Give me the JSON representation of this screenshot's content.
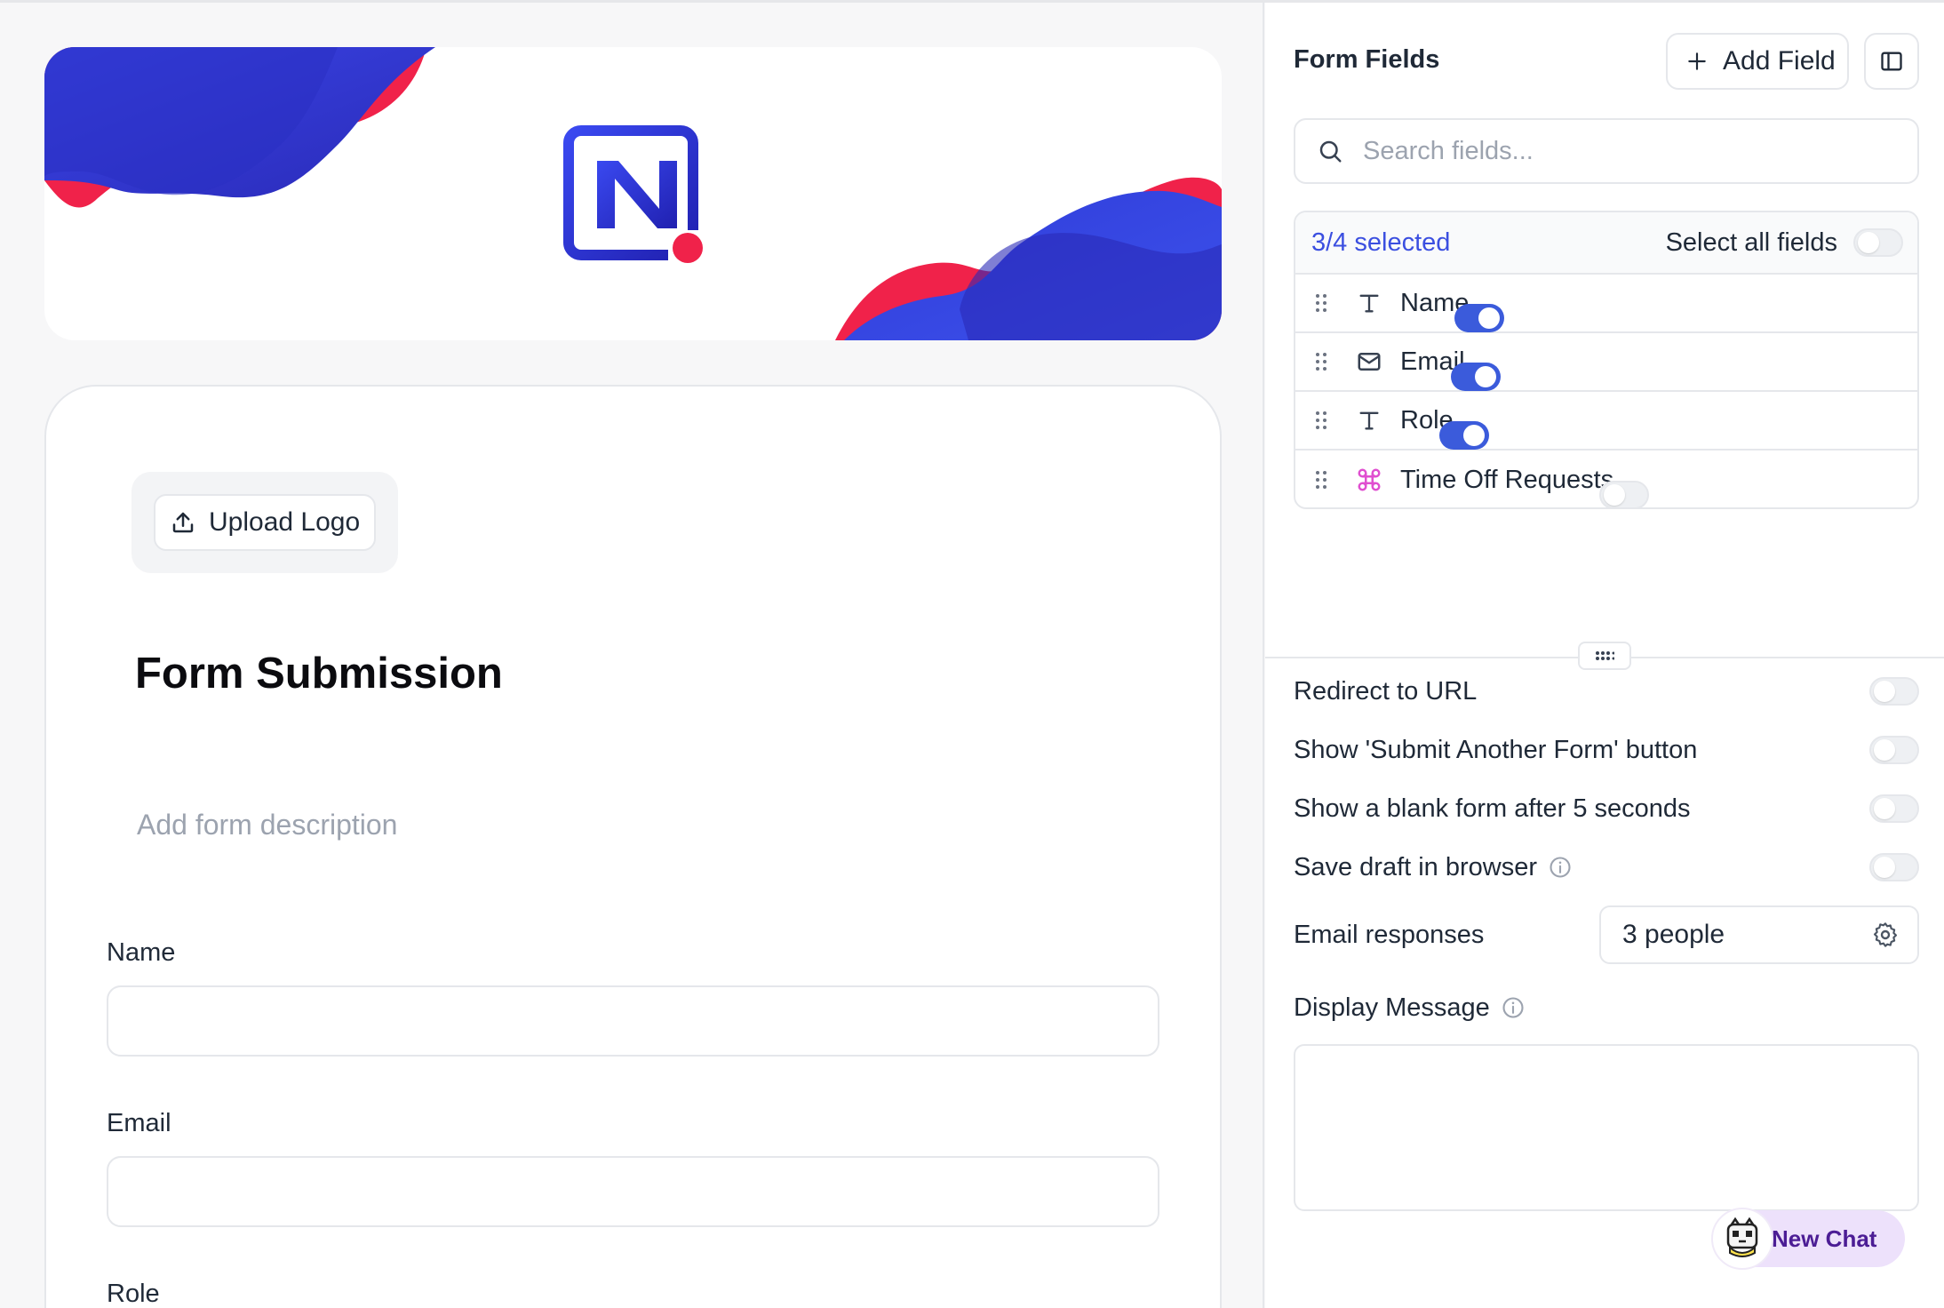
{
  "form": {
    "upload_logo_label": "Upload Logo",
    "title": "Form Submission",
    "description_placeholder": "Add form description",
    "fields": [
      {
        "label": "Name"
      },
      {
        "label": "Email"
      },
      {
        "label": "Role"
      }
    ]
  },
  "panel": {
    "title": "Form Fields",
    "add_field_label": "Add Field",
    "search_placeholder": "Search fields...",
    "selected_count": "3/4 selected",
    "select_all_label": "Select all fields",
    "select_all_on": false,
    "field_list": [
      {
        "name": "Name",
        "icon": "text-type-icon",
        "enabled": true
      },
      {
        "name": "Email",
        "icon": "mail-icon",
        "enabled": true
      },
      {
        "name": "Role",
        "icon": "text-type-icon",
        "enabled": true
      },
      {
        "name": "Time Off Requests",
        "icon": "command-icon",
        "enabled": false
      }
    ]
  },
  "settings": {
    "redirect_label": "Redirect to URL",
    "redirect_on": false,
    "submit_another_label": "Show 'Submit Another Form' button",
    "submit_another_on": false,
    "blank_form_label": "Show a blank form after 5 seconds",
    "blank_form_on": false,
    "save_draft_label": "Save draft in browser",
    "save_draft_on": false,
    "email_responses_label": "Email responses",
    "email_responses_value": "3 people",
    "display_message_label": "Display Message",
    "display_message_value": ""
  },
  "chat": {
    "new_chat_label": "New Chat"
  },
  "colors": {
    "accent": "#3b5bdb",
    "brand_blue": "#2f3fd6",
    "brand_red": "#f0224a",
    "command_icon": "#e04fd0"
  }
}
